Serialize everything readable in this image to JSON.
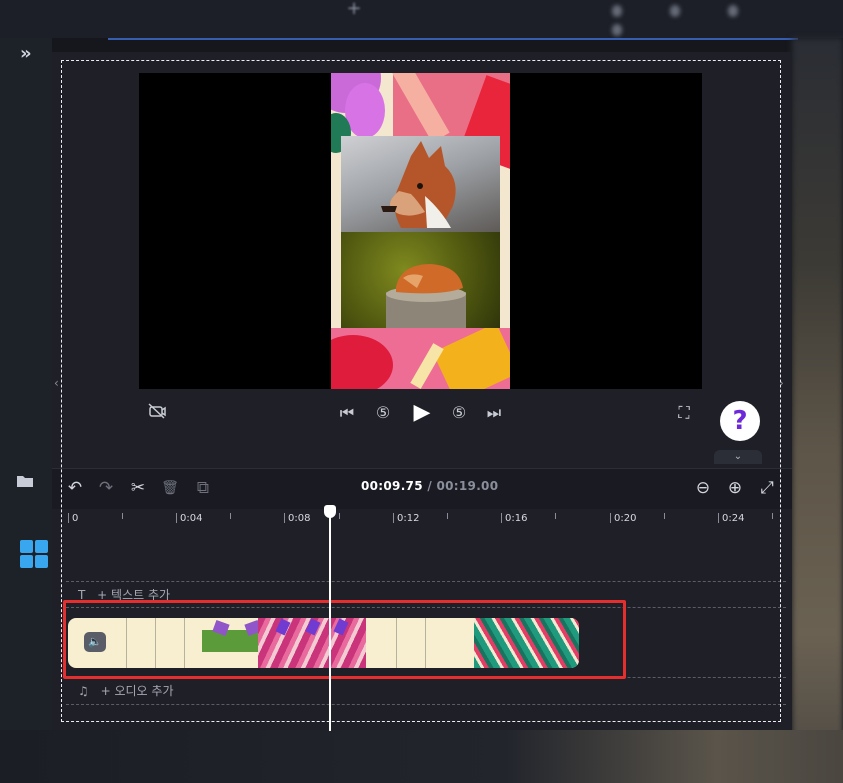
{
  "background": {
    "expand_icon_text": "»",
    "plus_icon_text": "+"
  },
  "player": {
    "controls": {
      "hide_icon": "camera-off-icon",
      "skip_back": "⏮",
      "rewind_5": "⑤",
      "play": "▶",
      "forward_5": "⑤",
      "skip_forward": "⏭",
      "fullscreen": "⛶"
    },
    "help_label": "?",
    "collapse_label": "⌄"
  },
  "timeline": {
    "toolbar": {
      "undo": "↶",
      "redo": "↷",
      "cut": "✂",
      "delete": "🗑",
      "duplicate": "⧉",
      "zoom_out": "⊖",
      "zoom_in": "⊕",
      "fit": "⤢"
    },
    "current_time": "00:09.75",
    "separator": " / ",
    "total_time": "00:19.00",
    "ruler_labels": [
      "0",
      "0:04",
      "0:08",
      "0:12",
      "0:16",
      "0:20",
      "0:24"
    ],
    "text_track_label": "+ 텍스트 추가",
    "audio_track_label": "+ 오디오 추가",
    "text_icon": "T",
    "audio_icon": "♫",
    "mute_icon": "🔈"
  },
  "colors": {
    "highlight": "#e52e2e",
    "help_mark": "#6d28d9",
    "clip_bg": "#f7efcf"
  }
}
